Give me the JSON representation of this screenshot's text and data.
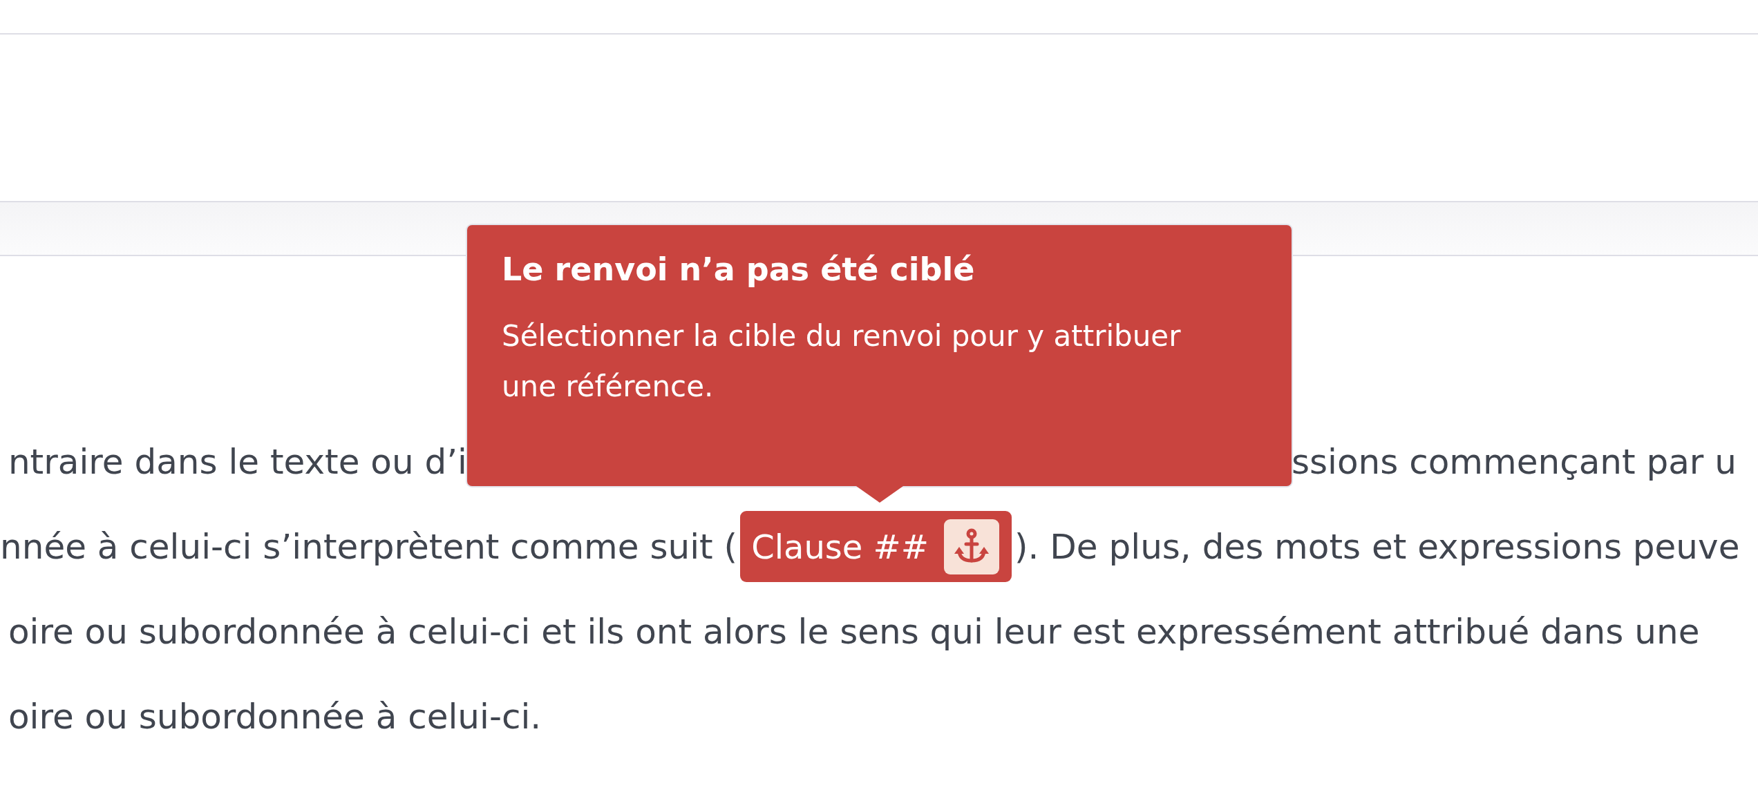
{
  "tooltip": {
    "title": "Le renvoi n’a pas été ciblé",
    "message": "Sélectionner la cible du renvoi pour y attribuer une référence."
  },
  "paragraph": {
    "lines": [
      {
        "kind": "split",
        "before": "ntraire dans le texte ou d’i",
        "after": "ssions commençant par u"
      },
      {
        "kind": "reference",
        "before": "nnée à celui-ci s’interprètent comme suit (",
        "reference": {
          "label": "Clause ##",
          "targeted": false
        },
        "after": "). De plus, des mots et expressions peuve"
      },
      {
        "kind": "plain",
        "text": "oire ou subordonnée à celui-ci et ils ont alors le sens qui leur est expressément attribué dans une"
      },
      {
        "kind": "plain",
        "text": "oire ou subordonnée à celui-ci."
      }
    ]
  }
}
